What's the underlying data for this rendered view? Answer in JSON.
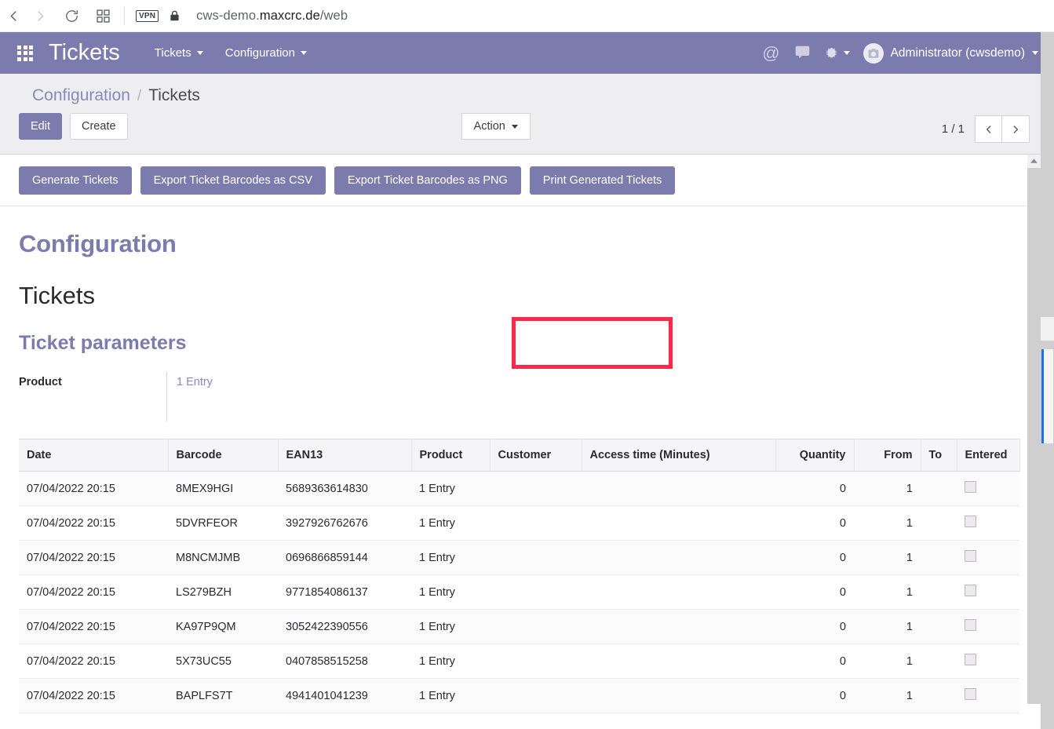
{
  "browser": {
    "back_icon": "back-arrow-icon",
    "forward_icon": "forward-arrow-icon",
    "reload_icon": "reload-icon",
    "tabs_icon": "tab-grid-icon",
    "vpn_label": "VPN",
    "lock_icon": "lock-icon",
    "url_prefix": "cws-demo.",
    "url_host": "maxcrc.de",
    "url_path": "/web"
  },
  "navbar": {
    "apps_icon": "apps-grid-icon",
    "brand": "Tickets",
    "menus": [
      {
        "label": "Tickets"
      },
      {
        "label": "Configuration"
      }
    ],
    "mail_icon": "at-sign-icon",
    "messages_icon": "chat-bubble-icon",
    "debug_icon": "bug-icon",
    "avatar_icon": "user-avatar-icon",
    "user": "Administrator (cwsdemo)",
    "bg_color": "#7c7bad"
  },
  "control_panel": {
    "breadcrumb": {
      "parent": "Configuration",
      "separator": "/",
      "current": "Tickets"
    },
    "edit_label": "Edit",
    "create_label": "Create",
    "action_label": "Action",
    "pager_count": "1 / 1",
    "prev_icon": "chevron-left-icon",
    "next_icon": "chevron-right-icon"
  },
  "object_buttons": [
    {
      "label": "Generate Tickets",
      "highlighted": false
    },
    {
      "label": "Export Ticket Barcodes as CSV",
      "highlighted": false
    },
    {
      "label": "Export Ticket Barcodes as PNG",
      "highlighted": false
    },
    {
      "label": "Print Generated Tickets",
      "highlighted": true
    }
  ],
  "highlight": {
    "color": "#f8294a"
  },
  "form": {
    "heading_config": "Configuration",
    "heading_tickets": "Tickets",
    "heading_params": "Ticket parameters",
    "product_label": "Product",
    "product_value": "1 Entry"
  },
  "table": {
    "columns": [
      {
        "label": "Date",
        "align": "left"
      },
      {
        "label": "Barcode",
        "align": "left"
      },
      {
        "label": "EAN13",
        "align": "left"
      },
      {
        "label": "Product",
        "align": "left"
      },
      {
        "label": "Customer",
        "align": "left"
      },
      {
        "label": "Access time (Minutes)",
        "align": "left"
      },
      {
        "label": "Quantity",
        "align": "right"
      },
      {
        "label": "From",
        "align": "right"
      },
      {
        "label": "To",
        "align": "left"
      },
      {
        "label": "Entered",
        "align": "left"
      }
    ],
    "rows": [
      {
        "date": "07/04/2022 20:15",
        "barcode": "8MEX9HGI",
        "ean13": "5689363614830",
        "product": "1 Entry",
        "customer": "",
        "access_time": "",
        "quantity": "0",
        "from": "1",
        "to": "",
        "entered": false
      },
      {
        "date": "07/04/2022 20:15",
        "barcode": "5DVRFEOR",
        "ean13": "3927926762676",
        "product": "1 Entry",
        "customer": "",
        "access_time": "",
        "quantity": "0",
        "from": "1",
        "to": "",
        "entered": false
      },
      {
        "date": "07/04/2022 20:15",
        "barcode": "M8NCMJMB",
        "ean13": "0696866859144",
        "product": "1 Entry",
        "customer": "",
        "access_time": "",
        "quantity": "0",
        "from": "1",
        "to": "",
        "entered": false
      },
      {
        "date": "07/04/2022 20:15",
        "barcode": "LS279BZH",
        "ean13": "9771854086137",
        "product": "1 Entry",
        "customer": "",
        "access_time": "",
        "quantity": "0",
        "from": "1",
        "to": "",
        "entered": false
      },
      {
        "date": "07/04/2022 20:15",
        "barcode": "KA97P9QM",
        "ean13": "3052422390556",
        "product": "1 Entry",
        "customer": "",
        "access_time": "",
        "quantity": "0",
        "from": "1",
        "to": "",
        "entered": false
      },
      {
        "date": "07/04/2022 20:15",
        "barcode": "5X73UC55",
        "ean13": "0407858515258",
        "product": "1 Entry",
        "customer": "",
        "access_time": "",
        "quantity": "0",
        "from": "1",
        "to": "",
        "entered": false
      },
      {
        "date": "07/04/2022 20:15",
        "barcode": "BAPLFS7T",
        "ean13": "4941401041239",
        "product": "1 Entry",
        "customer": "",
        "access_time": "",
        "quantity": "0",
        "from": "1",
        "to": "",
        "entered": false
      }
    ]
  }
}
